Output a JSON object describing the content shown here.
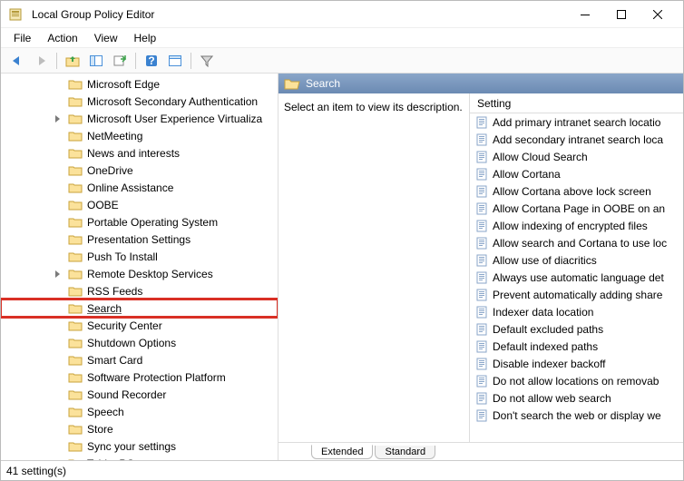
{
  "window": {
    "title": "Local Group Policy Editor"
  },
  "menus": [
    "File",
    "Action",
    "View",
    "Help"
  ],
  "tree": {
    "items": [
      {
        "label": "Microsoft Edge"
      },
      {
        "label": "Microsoft Secondary Authentication"
      },
      {
        "label": "Microsoft User Experience Virtualiza",
        "expandable": true
      },
      {
        "label": "NetMeeting"
      },
      {
        "label": "News and interests"
      },
      {
        "label": "OneDrive"
      },
      {
        "label": "Online Assistance"
      },
      {
        "label": "OOBE"
      },
      {
        "label": "Portable Operating System"
      },
      {
        "label": "Presentation Settings"
      },
      {
        "label": "Push To Install"
      },
      {
        "label": "Remote Desktop Services",
        "expandable": true
      },
      {
        "label": "RSS Feeds"
      },
      {
        "label": "Search",
        "selected": true
      },
      {
        "label": "Security Center"
      },
      {
        "label": "Shutdown Options"
      },
      {
        "label": "Smart Card"
      },
      {
        "label": "Software Protection Platform"
      },
      {
        "label": "Sound Recorder"
      },
      {
        "label": "Speech"
      },
      {
        "label": "Store"
      },
      {
        "label": "Sync your settings"
      },
      {
        "label": "Tablet PC"
      }
    ]
  },
  "right": {
    "header": "Search",
    "description": "Select an item to view its description.",
    "column": "Setting",
    "settings": [
      "Add primary intranet search locatio",
      "Add secondary intranet search loca",
      "Allow Cloud Search",
      "Allow Cortana",
      "Allow Cortana above lock screen",
      "Allow Cortana Page in OOBE on an",
      "Allow indexing of encrypted files",
      "Allow search and Cortana to use loc",
      "Allow use of diacritics",
      "Always use automatic language det",
      "Prevent automatically adding share",
      "Indexer data location",
      "Default excluded paths",
      "Default indexed paths",
      "Disable indexer backoff",
      "Do not allow locations on removab",
      "Do not allow web search",
      "Don't search the web or display we"
    ]
  },
  "tabs": {
    "extended": "Extended",
    "standard": "Standard"
  },
  "status": "41 setting(s)"
}
